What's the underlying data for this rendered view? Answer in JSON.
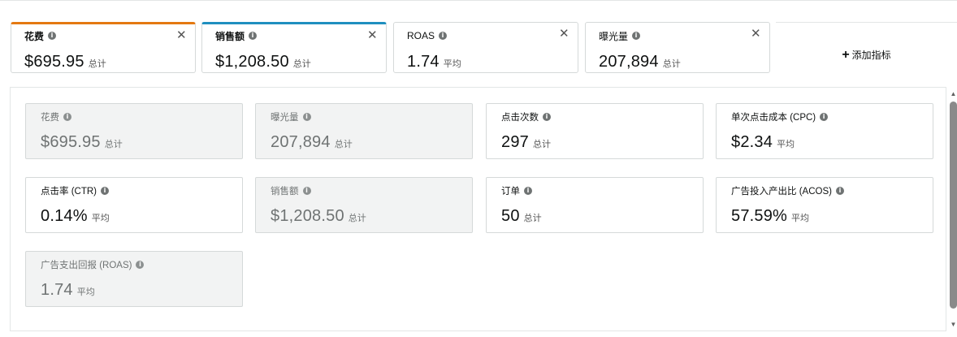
{
  "tabs": [
    {
      "label": "花费",
      "value": "$695.95",
      "unit": "总计",
      "color": "#e47911",
      "bold": true
    },
    {
      "label": "销售额",
      "value": "$1,208.50",
      "unit": "总计",
      "color": "#1f8fbf",
      "bold": true
    },
    {
      "label": "ROAS",
      "value": "1.74",
      "unit": "平均",
      "color": "#d5d9d9",
      "bold": false
    },
    {
      "label": "曝光量",
      "value": "207,894",
      "unit": "总计",
      "color": "#d5d9d9",
      "bold": false
    }
  ],
  "add_metric_label": "添加指标",
  "cards": [
    {
      "label": "花费",
      "value": "$695.95",
      "unit": "总计",
      "disabled": true
    },
    {
      "label": "曝光量",
      "value": "207,894",
      "unit": "总计",
      "disabled": true
    },
    {
      "label": "点击次数",
      "value": "297",
      "unit": "总计",
      "disabled": false
    },
    {
      "label": "单次点击成本 (CPC)",
      "value": "$2.34",
      "unit": "平均",
      "disabled": false
    },
    {
      "label": "点击率 (CTR)",
      "value": "0.14%",
      "unit": "平均",
      "disabled": false
    },
    {
      "label": "销售额",
      "value": "$1,208.50",
      "unit": "总计",
      "disabled": true
    },
    {
      "label": "订单",
      "value": "50",
      "unit": "总计",
      "disabled": false
    },
    {
      "label": "广告投入产出比 (ACOS)",
      "value": "57.59%",
      "unit": "平均",
      "disabled": false
    },
    {
      "label": "广告支出回报 (ROAS)",
      "value": "1.74",
      "unit": "平均",
      "disabled": true
    }
  ],
  "icons": {
    "info": "info-icon",
    "close": "close-icon",
    "add": "plus-icon"
  }
}
